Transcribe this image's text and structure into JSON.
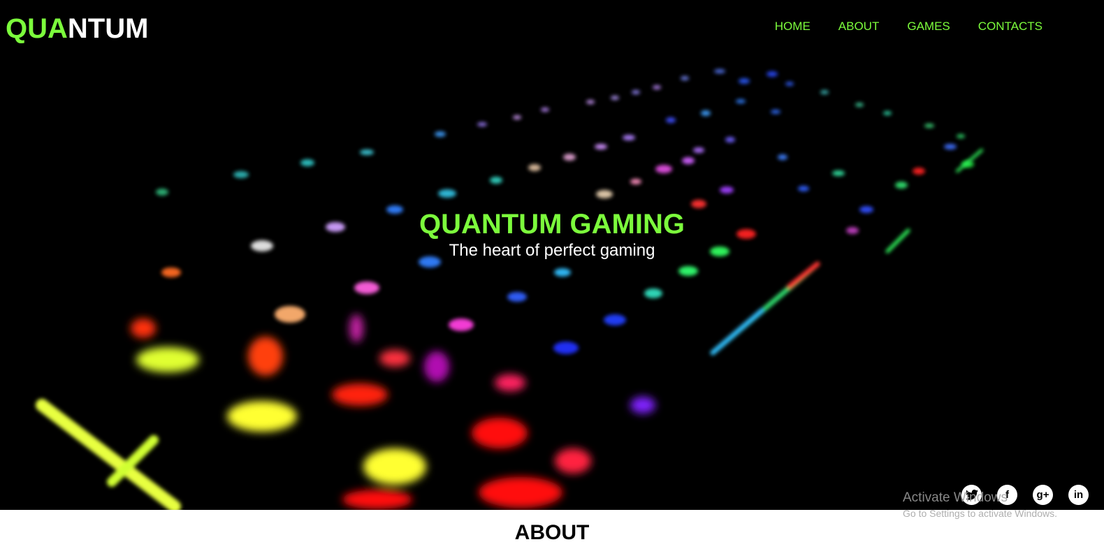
{
  "header": {
    "logo_part1": "QUA",
    "logo_part2": "NTUM",
    "nav": [
      {
        "label": "HOME"
      },
      {
        "label": "ABOUT"
      },
      {
        "label": "GAMES"
      },
      {
        "label": "CONTACTS"
      }
    ]
  },
  "hero": {
    "title": "QUANTUM GAMING",
    "subtitle": "The heart of perfect gaming"
  },
  "social": [
    {
      "icon": "twitter-icon",
      "glyph": "🐦"
    },
    {
      "icon": "facebook-icon",
      "glyph": "f"
    },
    {
      "icon": "google-plus-icon",
      "glyph": "g+"
    },
    {
      "icon": "linkedin-icon",
      "glyph": "in"
    }
  ],
  "watermark": {
    "line1": "Activate Windows",
    "line2": "Go to Settings to activate Windows."
  },
  "about": {
    "heading": "ABOUT"
  },
  "colors": {
    "accent": "#7cfc3c",
    "hero_bg": "#000000",
    "page_bg": "#ffffff"
  }
}
